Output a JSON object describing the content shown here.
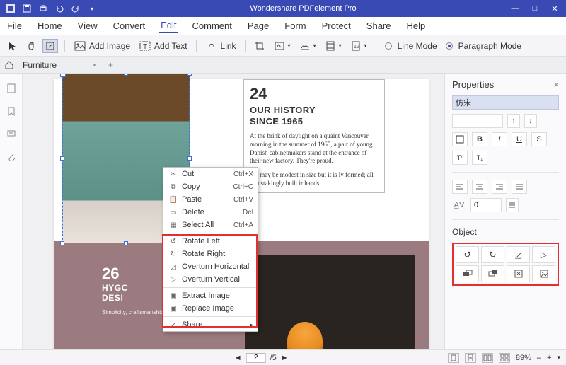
{
  "title": "Wondershare PDFelement Pro",
  "menu": {
    "items": [
      "File",
      "Home",
      "View",
      "Convert",
      "Edit",
      "Comment",
      "Page",
      "Form",
      "Protect",
      "Share",
      "Help"
    ],
    "active": "Edit"
  },
  "toolbar": {
    "addImage": "Add Image",
    "addText": "Add Text",
    "link": "Link",
    "lineMode": "Line Mode",
    "paragraphMode": "Paragraph Mode"
  },
  "tab": {
    "name": "Furniture"
  },
  "doc": {
    "num": "24",
    "head1": "OUR HISTORY",
    "head2": "SINCE 1965",
    "p1": "At the brink of daylight on a quaint Vancouver morning in the summer of 1965, a pair of young Danish cabinetmakers stand at the entrance of their new factory. They're proud.",
    "p2": "ace may be modest in size but it is ly formed; all painstakingly built ir hands.",
    "num2": "26",
    "head3": "HYGC",
    "head4": "DESI",
    "p3": "Simplicity, craftsmanship, elegant functionality and quality materials."
  },
  "ctx": [
    {
      "icon": "✂",
      "label": "Cut",
      "sc": "Ctrl+X"
    },
    {
      "icon": "⧉",
      "label": "Copy",
      "sc": "Ctrl+C"
    },
    {
      "icon": "📋",
      "label": "Paste",
      "sc": "Ctrl+V"
    },
    {
      "icon": "▭",
      "label": "Delete",
      "sc": "Del"
    },
    {
      "icon": "▦",
      "label": "Select All",
      "sc": "Ctrl+A"
    },
    {
      "div": true
    },
    {
      "icon": "↺",
      "label": "Rotate Left"
    },
    {
      "icon": "↻",
      "label": "Rotate Right"
    },
    {
      "icon": "◿",
      "label": "Overturn Horizontal"
    },
    {
      "icon": "▷",
      "label": "Overturn Vertical"
    },
    {
      "div": true
    },
    {
      "icon": "▣",
      "label": "Extract Image"
    },
    {
      "icon": "▣",
      "label": "Replace Image"
    },
    {
      "div": true
    },
    {
      "icon": "↗",
      "label": "Share",
      "arrow": true
    }
  ],
  "props": {
    "title": "Properties",
    "font": "仿宋",
    "spacing": "0",
    "objectTitle": "Object"
  },
  "status": {
    "page": "2",
    "total": "/5",
    "zoom": "89%"
  }
}
